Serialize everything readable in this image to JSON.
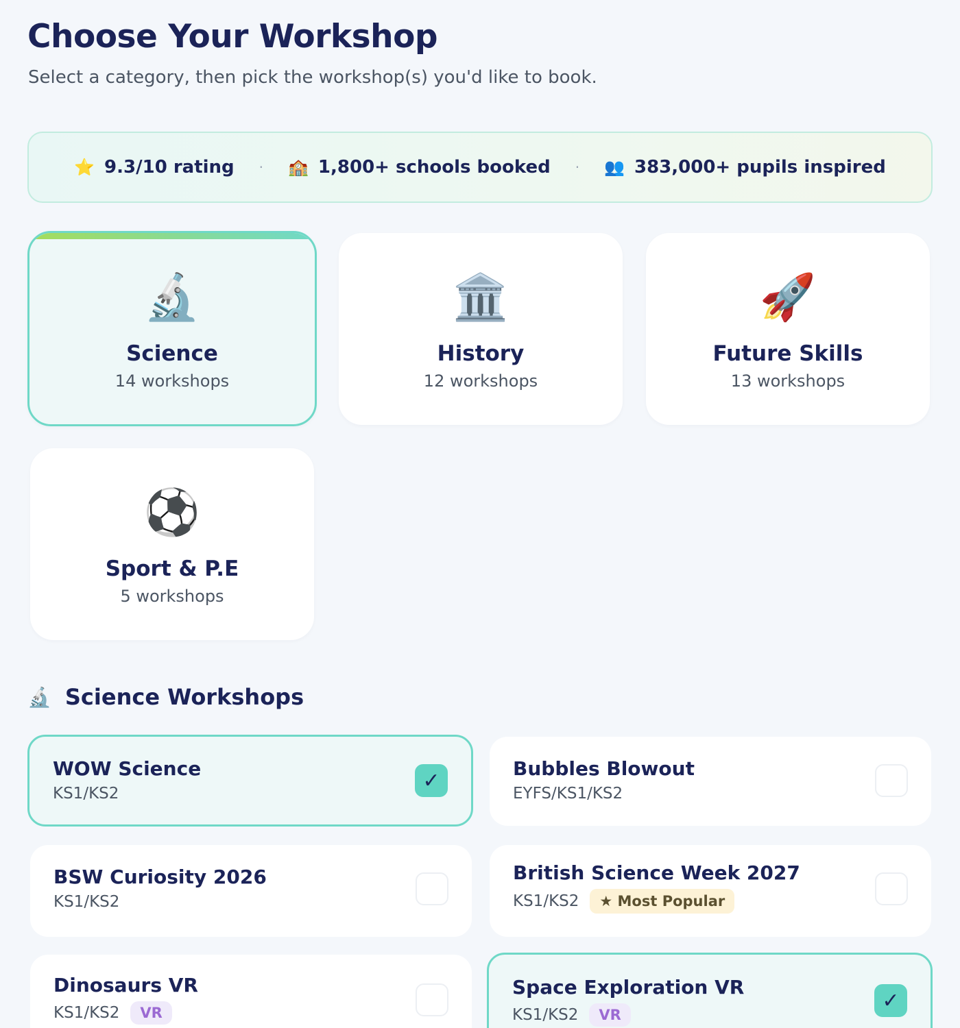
{
  "header": {
    "title": "Choose Your Workshop",
    "subtitle": "Select a category, then pick the workshop(s) you'd like to book."
  },
  "stats": [
    {
      "icon": "⭐",
      "icon_name": "star-icon",
      "text": "9.3/10 rating"
    },
    {
      "icon": "🏫",
      "icon_name": "school-icon",
      "text": "1,800+ schools booked"
    },
    {
      "icon": "👥",
      "icon_name": "people-icon",
      "text": "383,000+ pupils inspired"
    }
  ],
  "stats_separator": "·",
  "categories": [
    {
      "icon": "🔬",
      "icon_name": "microscope-icon",
      "name": "Science",
      "count": "14 workshops",
      "selected": true
    },
    {
      "icon": "🏛️",
      "icon_name": "museum-icon",
      "name": "History",
      "count": "12 workshops",
      "selected": false
    },
    {
      "icon": "🚀",
      "icon_name": "rocket-icon",
      "name": "Future Skills",
      "count": "13 workshops",
      "selected": false
    },
    {
      "icon": "⚽",
      "icon_name": "football-icon",
      "name": "Sport & P.E",
      "count": "5 workshops",
      "selected": false
    }
  ],
  "section": {
    "icon": "🔬",
    "icon_name": "microscope-icon",
    "title": "Science Workshops"
  },
  "workshops": [
    {
      "name": "WOW Science",
      "age": "KS1/KS2",
      "badge": "",
      "selected": true
    },
    {
      "name": "Bubbles Blowout",
      "age": "EYFS/KS1/KS2",
      "badge": "",
      "selected": false
    },
    {
      "name": "BSW Curiosity 2026",
      "age": "KS1/KS2",
      "badge": "",
      "selected": false
    },
    {
      "name": "British Science Week 2027",
      "age": "KS1/KS2",
      "badge": "★ Most Popular",
      "selected": false
    },
    {
      "name": "Dinosaurs VR",
      "age": "KS1/KS2",
      "badge": "VR",
      "selected": false
    },
    {
      "name": "Space Exploration VR",
      "age": "KS1/KS2",
      "badge": "VR",
      "selected": true
    }
  ],
  "check_glyph": "✓",
  "colors": {
    "accent": "#6fd8c7",
    "title": "#1b2358",
    "selected_bg": "#eef8f8",
    "popular_bg": "#fdf2d6",
    "vr_text": "#9b6ad3"
  }
}
